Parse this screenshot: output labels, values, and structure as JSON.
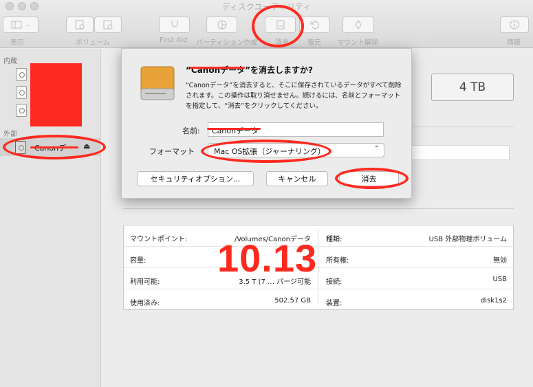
{
  "window": {
    "title": "ディスクユーティリティ"
  },
  "toolbar": {
    "view_label": "表示",
    "volume_label": "ボリューム",
    "firstaid_label": "First Aid",
    "partition_label": "パーティション作成",
    "erase_label": "消去",
    "restore_label": "復元",
    "mount_label": "マウント解除",
    "info_label": "情報"
  },
  "sidebar": {
    "internal_label": "内蔵",
    "external_label": "外部",
    "selected_disk": "Canonデ",
    "eject_glyph": "⏏"
  },
  "main": {
    "capacity_badge": "4 TB"
  },
  "info": {
    "rows": [
      {
        "k1": "マウントポイント:",
        "v1": "/Volumes/Canonデータ",
        "k2": "種類:",
        "v2": "USB 外部物理ボリューム"
      },
      {
        "k1": "容量:",
        "v1": "B",
        "k2": "所有権:",
        "v2": "無効"
      },
      {
        "k1": "利用可能:",
        "v1": "3.5 T  (7 … パージ可能",
        "k2": "接続:",
        "v2": "USB"
      },
      {
        "k1": "使用済み:",
        "v1": "502.57 GB",
        "k2": "装置:",
        "v2": "disk1s2"
      }
    ]
  },
  "overlay_text": "10.13",
  "dialog": {
    "title": "“Canonデータ”を消去しますか?",
    "body": "“Canonデータ”を消去すると、そこに保存されているデータがすべて削除されます。この操作は取り消せません。続けるには、名前とフォーマットを指定して、“消去”をクリックしてください。",
    "name_label": "名前:",
    "name_value": "Canonデータ",
    "format_label": "フォーマット",
    "format_value": "Mac OS拡張（ジャーナリング）",
    "security_button": "セキュリティオプション...",
    "cancel_button": "キャンセル",
    "erase_button": "消去"
  },
  "colors": {
    "annotation_red": "#ff2a1f",
    "accent": "#ececec"
  }
}
